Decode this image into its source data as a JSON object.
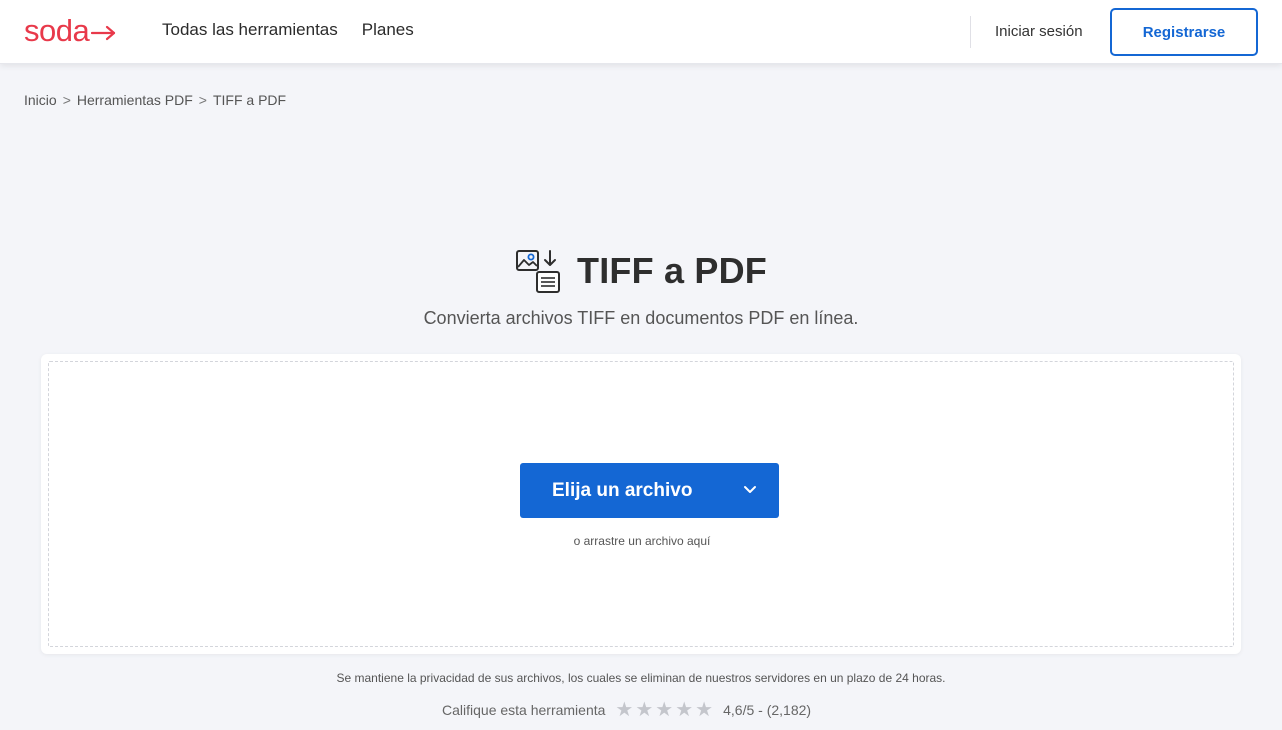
{
  "header": {
    "logo_text": "soda",
    "nav": [
      {
        "label": "Todas las herramientas"
      },
      {
        "label": "Planes"
      }
    ],
    "login_label": "Iniciar sesión",
    "register_label": "Registrarse"
  },
  "breadcrumb": {
    "items": [
      "Inicio",
      "Herramientas PDF",
      "TIFF a PDF"
    ],
    "separator": ">"
  },
  "main": {
    "title": "TIFF a PDF",
    "subtitle": "Convierta archivos TIFF en documentos PDF en línea.",
    "choose_button_label": "Elija un archivo",
    "drag_hint": "o arrastre un archivo aquí"
  },
  "footer": {
    "privacy_note": "Se mantiene la privacidad de sus archivos, los cuales se eliminan de nuestros servidores en un plazo de 24 horas.",
    "rate_label": "Califique esta herramienta",
    "rating_text": "4,6/5 - (2,182)",
    "rating_value": 4.6,
    "rating_count": 2182,
    "stars_total": 5
  },
  "colors": {
    "brand_red": "#e8394a",
    "primary_blue": "#1467d4",
    "page_bg": "#f4f5f9",
    "star_gray": "#c4c6cc"
  },
  "icons": {
    "logo_arrow": "arrow-right-icon",
    "tool": "image-to-document-icon",
    "dropdown": "chevron-down-icon",
    "star": "star-icon"
  }
}
